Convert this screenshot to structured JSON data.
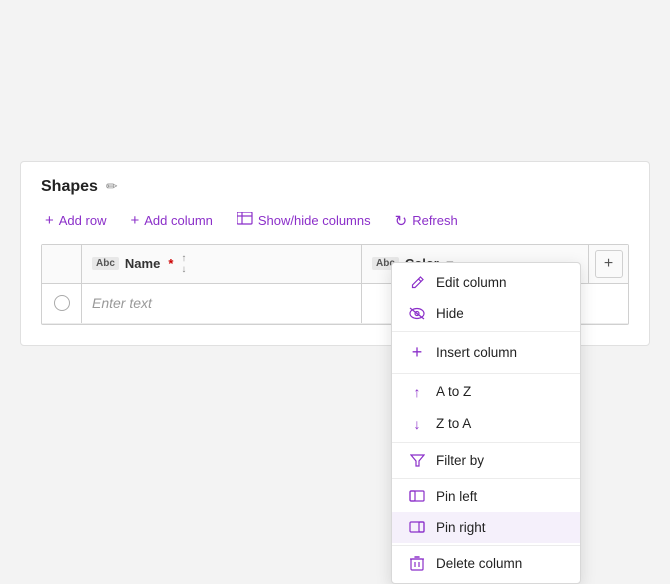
{
  "title": "Shapes",
  "toolbar": {
    "add_row": "Add row",
    "add_column": "Add column",
    "show_hide": "Show/hide columns",
    "refresh": "Refresh"
  },
  "table": {
    "columns": [
      {
        "name": "Name",
        "badge": "Abc",
        "required": true
      },
      {
        "name": "Color",
        "badge": "Abc"
      }
    ],
    "add_col_label": "+",
    "placeholder": "Enter text"
  },
  "dropdown": {
    "items": [
      {
        "id": "edit-column",
        "label": "Edit column",
        "icon": "pencil"
      },
      {
        "id": "hide",
        "label": "Hide",
        "icon": "eye-off"
      },
      {
        "id": "insert-column",
        "label": "Insert column",
        "icon": "plus"
      },
      {
        "id": "a-to-z",
        "label": "A to Z",
        "icon": "arrow-up"
      },
      {
        "id": "z-to-a",
        "label": "Z to A",
        "icon": "arrow-down"
      },
      {
        "id": "filter-by",
        "label": "Filter by",
        "icon": "filter"
      },
      {
        "id": "pin-left",
        "label": "Pin left",
        "icon": "pin-left"
      },
      {
        "id": "pin-right",
        "label": "Pin right",
        "icon": "pin-right"
      },
      {
        "id": "delete-column",
        "label": "Delete column",
        "icon": "trash"
      }
    ]
  },
  "icons": {
    "pencil": "✏",
    "eye-off": "👁",
    "plus": "+",
    "arrow-up": "↑",
    "arrow-down": "↓",
    "filter": "⊽",
    "pin-left": "▭",
    "pin-right": "▭",
    "trash": "🗑",
    "edit-small": "✏",
    "refresh-icon": "↻",
    "show-hide-icon": "⊞",
    "plus-icon": "+"
  }
}
